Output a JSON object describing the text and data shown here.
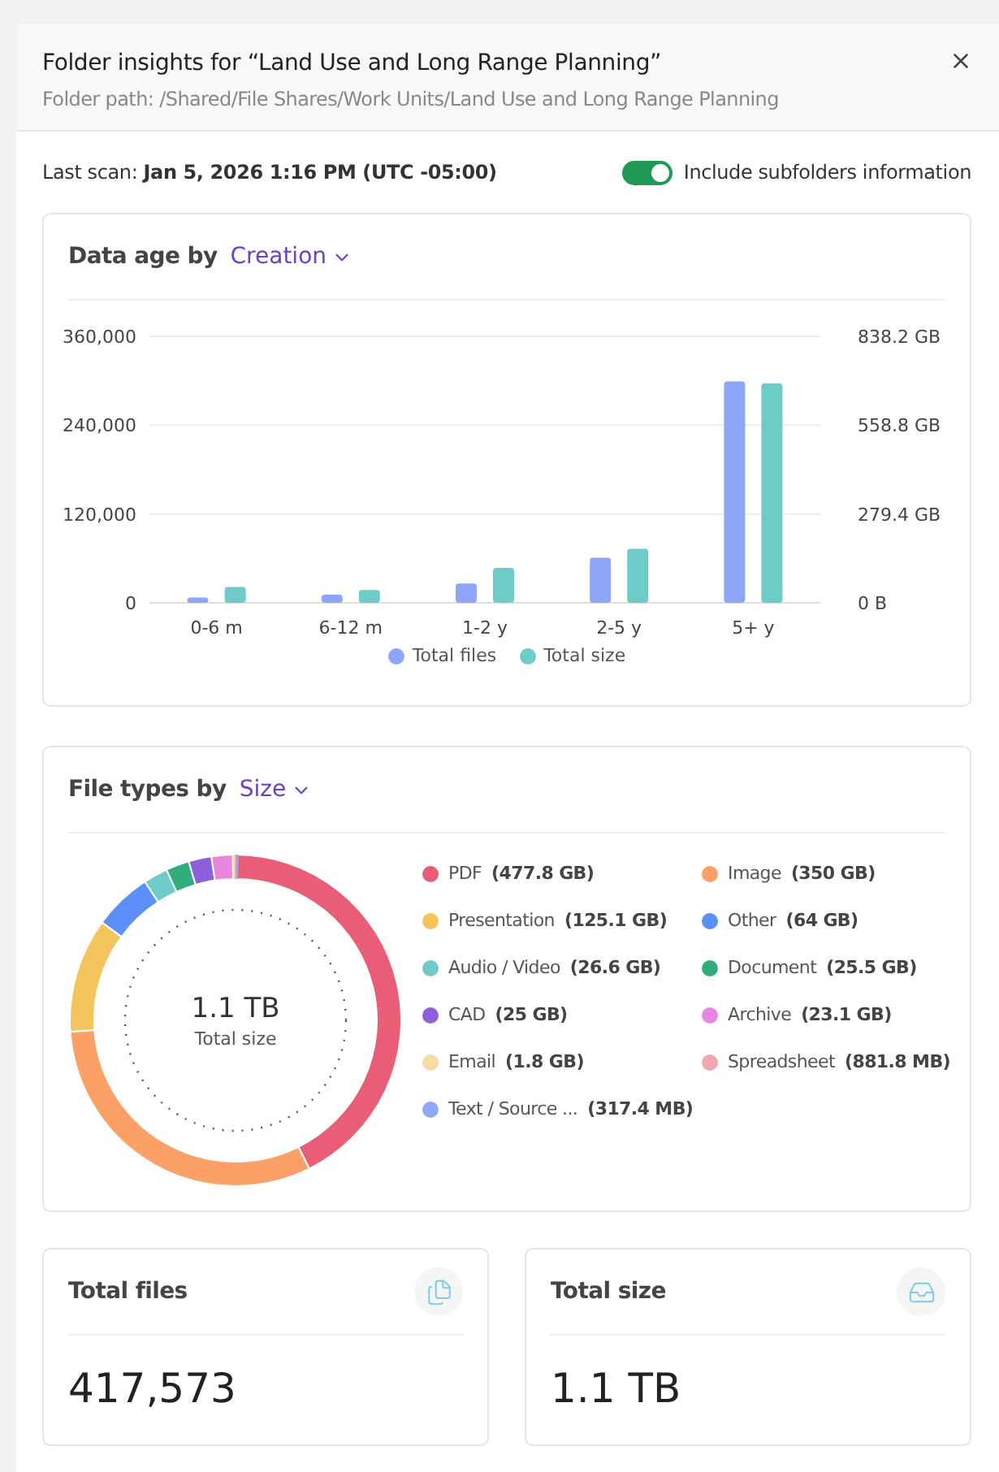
{
  "dialog": {
    "title": "Folder insights for “Land Use and Long Range Planning”",
    "path": "Folder path: /Shared/File Shares/Work Units/Land Use and Long Range Planning"
  },
  "scan": {
    "label": "Last scan:",
    "value": "Jan 5, 2026 1:16 PM (UTC -05:00)"
  },
  "subfolders_toggle": {
    "label": "Include subfolders information",
    "on": true
  },
  "data_age": {
    "title": "Data age by",
    "dropdown": "Creation",
    "chart_data": {
      "type": "bar",
      "categories": [
        "0-6 m",
        "6-12 m",
        "1-2 y",
        "2-5 y",
        "5+ y"
      ],
      "series": [
        {
          "name": "Total files",
          "color": "#8fa5f7",
          "values": [
            7000,
            11000,
            26000,
            61000,
            299000
          ]
        },
        {
          "name": "Total size",
          "color": "#6ecbc8",
          "axis": "y2",
          "values": [
            50,
            40,
            110,
            170,
            690
          ]
        }
      ],
      "ylim": [
        0,
        360000
      ],
      "yticks": [
        {
          "value": 0,
          "label": "0"
        },
        {
          "value": 120000,
          "label": "120,000"
        },
        {
          "value": 240000,
          "label": "240,000"
        },
        {
          "value": 360000,
          "label": "360,000"
        }
      ],
      "y2lim": [
        0,
        838.2
      ],
      "y2ticks": [
        {
          "value": 0,
          "label": "0 B"
        },
        {
          "value": 279.4,
          "label": "279.4 GB"
        },
        {
          "value": 558.8,
          "label": "558.8 GB"
        },
        {
          "value": 838.2,
          "label": "838.2 GB"
        }
      ]
    }
  },
  "file_types": {
    "title": "File types by",
    "dropdown": "Size",
    "center_value": "1.1 TB",
    "center_label": "Total size",
    "legend": [
      {
        "value": "(477.8 GB)",
        "color": "#e95d76"
      },
      {
        "value": "(350 GB)",
        "color": "#fca068"
      },
      {
        "value": "(125.1 GB)",
        "color": "#f4c55c"
      },
      {
        "value": "(64 GB)",
        "color": "#5b8ff9"
      },
      {
        "value": "(26.6 GB)",
        "color": "#6fcbc9"
      },
      {
        "value": "(25.5 GB)",
        "color": "#2fae7c"
      },
      {
        "value": "(25 GB)",
        "color": "#8e5fdb"
      },
      {
        "value": "(23.1 GB)",
        "color": "#e987e0"
      },
      {
        "value": "(1.8 GB)",
        "color": "#f7dca6"
      },
      {
        "value": "(881.8 MB)",
        "color": "#f2a7ae"
      },
      {
        "value": "(317.4 MB)",
        "color": "#8fa8f8"
      }
    ],
    "chart_data": {
      "type": "donut",
      "categories": [
        "PDF",
        "Image",
        "Presentation",
        "Other",
        "Audio / Video",
        "Document",
        "CAD",
        "Archive",
        "Email",
        "Spreadsheet",
        "Text / Source ..."
      ],
      "values": [
        42.657,
        31.247,
        11.168,
        5.714,
        2.375,
        2.277,
        2.232,
        2.062,
        0.161,
        0.079,
        0.028
      ]
    }
  },
  "stats": [
    {
      "kind": "files",
      "title": "Total files",
      "value": "417,573"
    },
    {
      "kind": "size",
      "title": "Total size",
      "value": "1.1 TB"
    }
  ]
}
